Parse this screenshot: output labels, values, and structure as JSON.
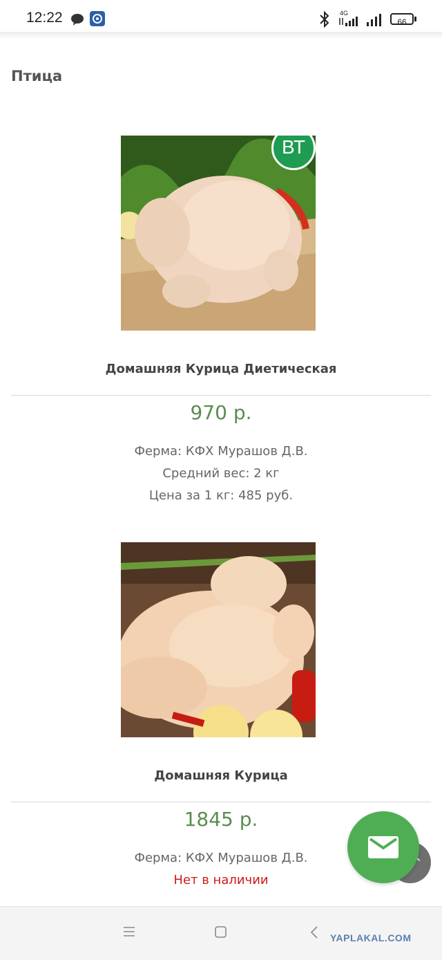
{
  "status_bar": {
    "time": "12:22",
    "network": "4G",
    "battery": "66",
    "icons": [
      "chat-bubble-icon",
      "app-notification-icon",
      "bluetooth-icon",
      "signal-icon",
      "signal-icon",
      "battery-icon"
    ]
  },
  "section": {
    "title": "Птица"
  },
  "products": [
    {
      "badge": "ВТ",
      "name": "Домашняя Курица Диетическая",
      "price": "970 р.",
      "farm": "Ферма: КФХ Мурашов Д.В.",
      "weight": "Средний вес: 2 кг",
      "price_per_kg": "Цена за 1 кг: 485 руб."
    },
    {
      "name": "Домашняя Курица",
      "price": "1845 р.",
      "farm": "Ферма: КФХ Мурашов Д.В.",
      "availability": "Нет в наличии"
    }
  ],
  "colors": {
    "price_green": "#5b8c51",
    "fab_green": "#4fae54",
    "out_of_stock_red": "#cc1a1a",
    "badge_green": "#1e9c52"
  },
  "fab": {
    "icon": "mail-icon"
  },
  "watermark": "YAPLAKAL.COM"
}
